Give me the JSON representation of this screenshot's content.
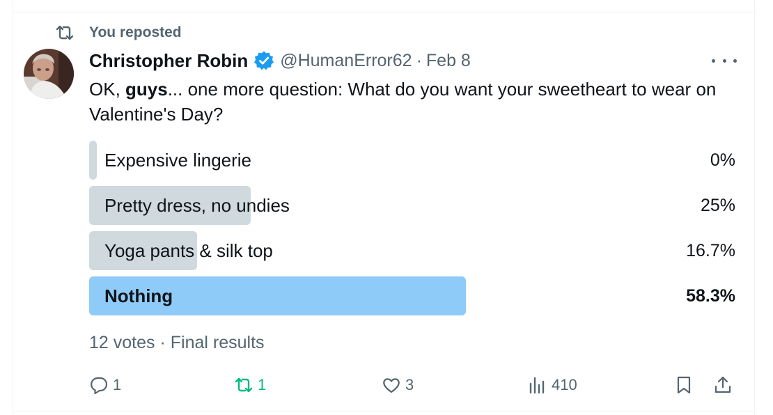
{
  "repost_banner": {
    "text": "You reposted"
  },
  "author": {
    "name": "Christopher Robin",
    "handle": "@HumanError62",
    "separator": "·",
    "date": "Feb 8"
  },
  "tweet": {
    "text_before": "OK, ",
    "text_bold": "guys",
    "text_after": "... one more question: What do you want your sweetheart to wear on Valentine's Day?"
  },
  "poll": {
    "options": [
      {
        "label": "Expensive lingerie",
        "percent_label": "0%",
        "percent": 0,
        "winner": false
      },
      {
        "label": "Pretty dress, no undies",
        "percent_label": "25%",
        "percent": 25,
        "winner": false
      },
      {
        "label": "Yoga pants & silk top",
        "percent_label": "16.7%",
        "percent": 16.7,
        "winner": false
      },
      {
        "label": "Nothing",
        "percent_label": "58.3%",
        "percent": 58.3,
        "winner": true
      }
    ],
    "votes": "12 votes",
    "separator": "·",
    "status": "Final results"
  },
  "actions": {
    "replies": "1",
    "reposts": "1",
    "likes": "3",
    "views": "410"
  },
  "colors": {
    "bar": "#cfd9de",
    "winner_bar": "#8ecbf8",
    "repost_active": "#00ba7c",
    "muted": "#536471",
    "verified": "#1d9bf0"
  }
}
